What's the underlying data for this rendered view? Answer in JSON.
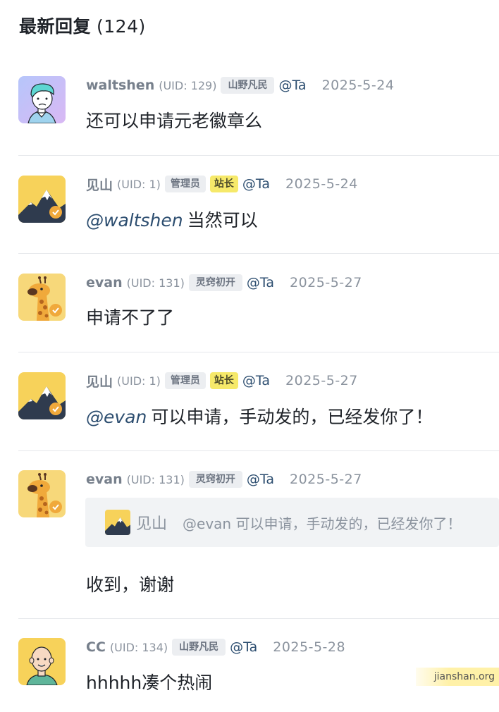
{
  "section": {
    "title": "最新回复",
    "count": "(124)"
  },
  "comments": [
    {
      "name": "waltshen",
      "uid": "(UID: 129)",
      "badges": [
        "山野凡民"
      ],
      "at": "@Ta",
      "date": "2025-5-24",
      "mention": "",
      "text": "还可以申请元老徽章么",
      "avatar": "avatar-man-blue-hair"
    },
    {
      "name": "见山",
      "uid": "(UID: 1)",
      "badges": [
        "管理员",
        "站长"
      ],
      "at": "@Ta",
      "date": "2025-5-24",
      "mention": "@waltshen",
      "text": "当然可以",
      "avatar": "avatar-mountain"
    },
    {
      "name": "evan",
      "uid": "(UID: 131)",
      "badges": [
        "灵窍初开"
      ],
      "at": "@Ta",
      "date": "2025-5-27",
      "mention": "",
      "text": "申请不了了",
      "avatar": "avatar-giraffe"
    },
    {
      "name": "见山",
      "uid": "(UID: 1)",
      "badges": [
        "管理员",
        "站长"
      ],
      "at": "@Ta",
      "date": "2025-5-27",
      "mention": "@evan",
      "text": "可以申请，手动发的，已经发你了！",
      "avatar": "avatar-mountain"
    },
    {
      "name": "evan",
      "uid": "(UID: 131)",
      "badges": [
        "灵窍初开"
      ],
      "at": "@Ta",
      "date": "2025-5-27",
      "mention": "",
      "text": "收到，谢谢",
      "avatar": "avatar-giraffe",
      "quote": {
        "name": "见山",
        "text": "@evan 可以申请，手动发的，已经发你了！"
      }
    },
    {
      "name": "CC",
      "uid": "(UID: 134)",
      "badges": [
        "山野凡民"
      ],
      "at": "@Ta",
      "date": "2025-5-28",
      "mention": "",
      "text": "hhhhh凑个热闹",
      "avatar": "avatar-bald-man"
    }
  ],
  "watermark": "jianshan.org",
  "colors": {
    "owner_badge": "#f6e96a",
    "badge": "#eceef1",
    "mention": "#2d4e70",
    "verified": "#f0a93b"
  }
}
